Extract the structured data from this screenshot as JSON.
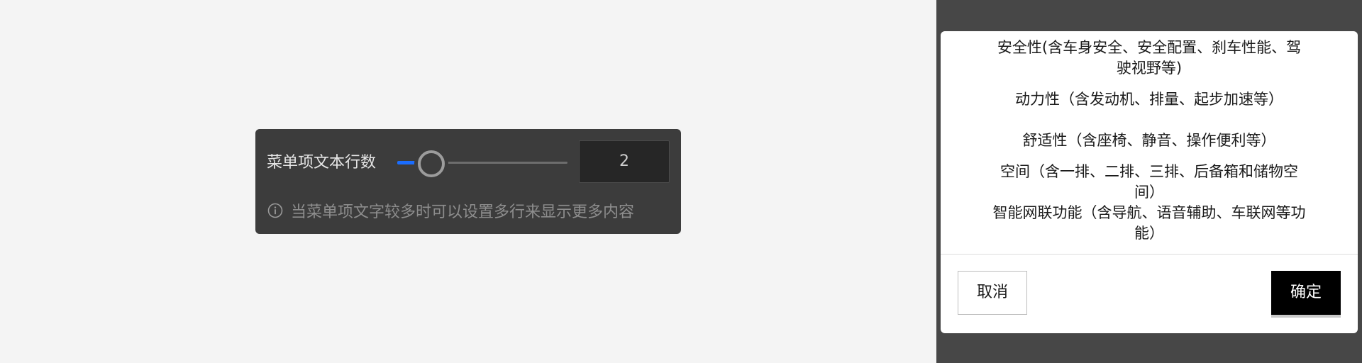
{
  "settings": {
    "label": "菜单项文本行数",
    "slider": {
      "value": 2,
      "fill_fraction": 0.2,
      "accent_color": "#1a6dff"
    },
    "value_display": "2",
    "hint_icon": "info-circle-icon",
    "hint": "当菜单项文字较多时可以设置多行来显示更多内容"
  },
  "dialog": {
    "menu_items": [
      "安全性(含车身安全、安全配置、刹车性能、驾驶视野等)",
      "动力性（含发动机、排量、起步加速等）",
      "舒适性（含座椅、静音、操作便利等）",
      "空间（含一排、二排、三排、后备箱和储物空间）",
      "智能网联功能（含导航、语音辅助、车联网等功能）"
    ],
    "cancel_label": "取消",
    "confirm_label": "确定"
  }
}
